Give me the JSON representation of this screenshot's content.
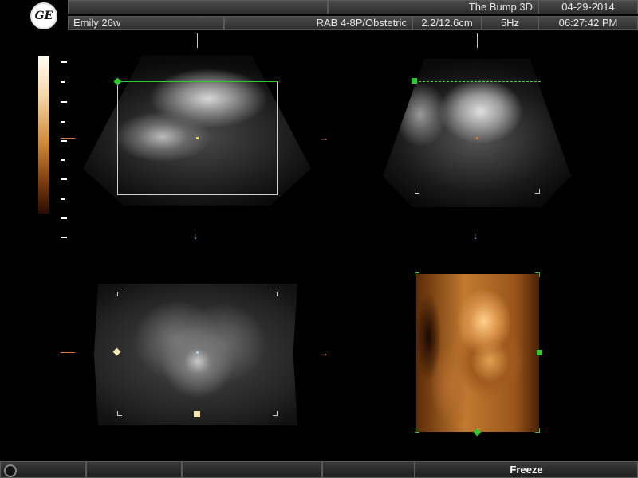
{
  "header": {
    "logo": "GE",
    "patient_name": "Emily 26w",
    "title": "The Bump 3D",
    "probe_preset": "RAB 4-8P/Obstetric",
    "depth": "2.2/12.6cm",
    "frequency": "5Hz",
    "date": "04-29-2014",
    "time": "06:27:42 PM"
  },
  "views": [
    {
      "name": "plane-a"
    },
    {
      "name": "plane-b"
    },
    {
      "name": "plane-c"
    },
    {
      "name": "render-3d"
    }
  ],
  "footer": {
    "freeze_label": "Freeze"
  },
  "colors": {
    "accent_green": "#2ecc2e",
    "marker_orange": "#e0743a",
    "arrow_blue": "#9ad0ff",
    "header_bg": "#3a3a3a"
  }
}
